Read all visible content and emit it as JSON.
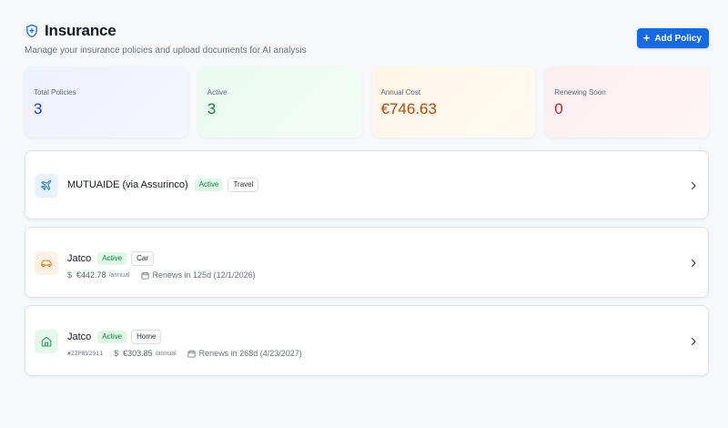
{
  "header": {
    "title": "Insurance",
    "subtitle": "Manage your insurance policies and upload documents for AI analysis",
    "add_button": "Add Policy",
    "title_icon": "shield-plus-icon"
  },
  "stats": [
    {
      "label": "Total Policies",
      "value": "3"
    },
    {
      "label": "Active",
      "value": "3"
    },
    {
      "label": "Annual Cost",
      "value": "€746.63"
    },
    {
      "label": "Renewing Soon",
      "value": "0"
    }
  ],
  "policies": [
    {
      "name": "MUTUAIDE (via Assurinco)",
      "status": "Active",
      "type": "Travel",
      "icon": "plane-icon",
      "icon_color": "#1f7bd6"
    },
    {
      "name": "Jatco",
      "status": "Active",
      "type": "Car",
      "icon": "car-icon",
      "icon_color": "#e2842a",
      "currency_symbol": "$",
      "price": "€442.78",
      "period": "/annual",
      "renewal": "Renews in 125d (12/1/2026)"
    },
    {
      "name": "Jatco",
      "status": "Active",
      "type": "Home",
      "icon": "home-icon",
      "icon_color": "#22a55a",
      "reference": "#ZZP8V2911",
      "currency_symbol": "$",
      "price": "€303.85",
      "period": "/annual",
      "renewal": "Renews in 268d (4/23/2027)"
    }
  ],
  "colors": {
    "accent": "#1769e0",
    "active_badge_bg": "#def7e7",
    "active_badge_text": "#1c7f48"
  }
}
